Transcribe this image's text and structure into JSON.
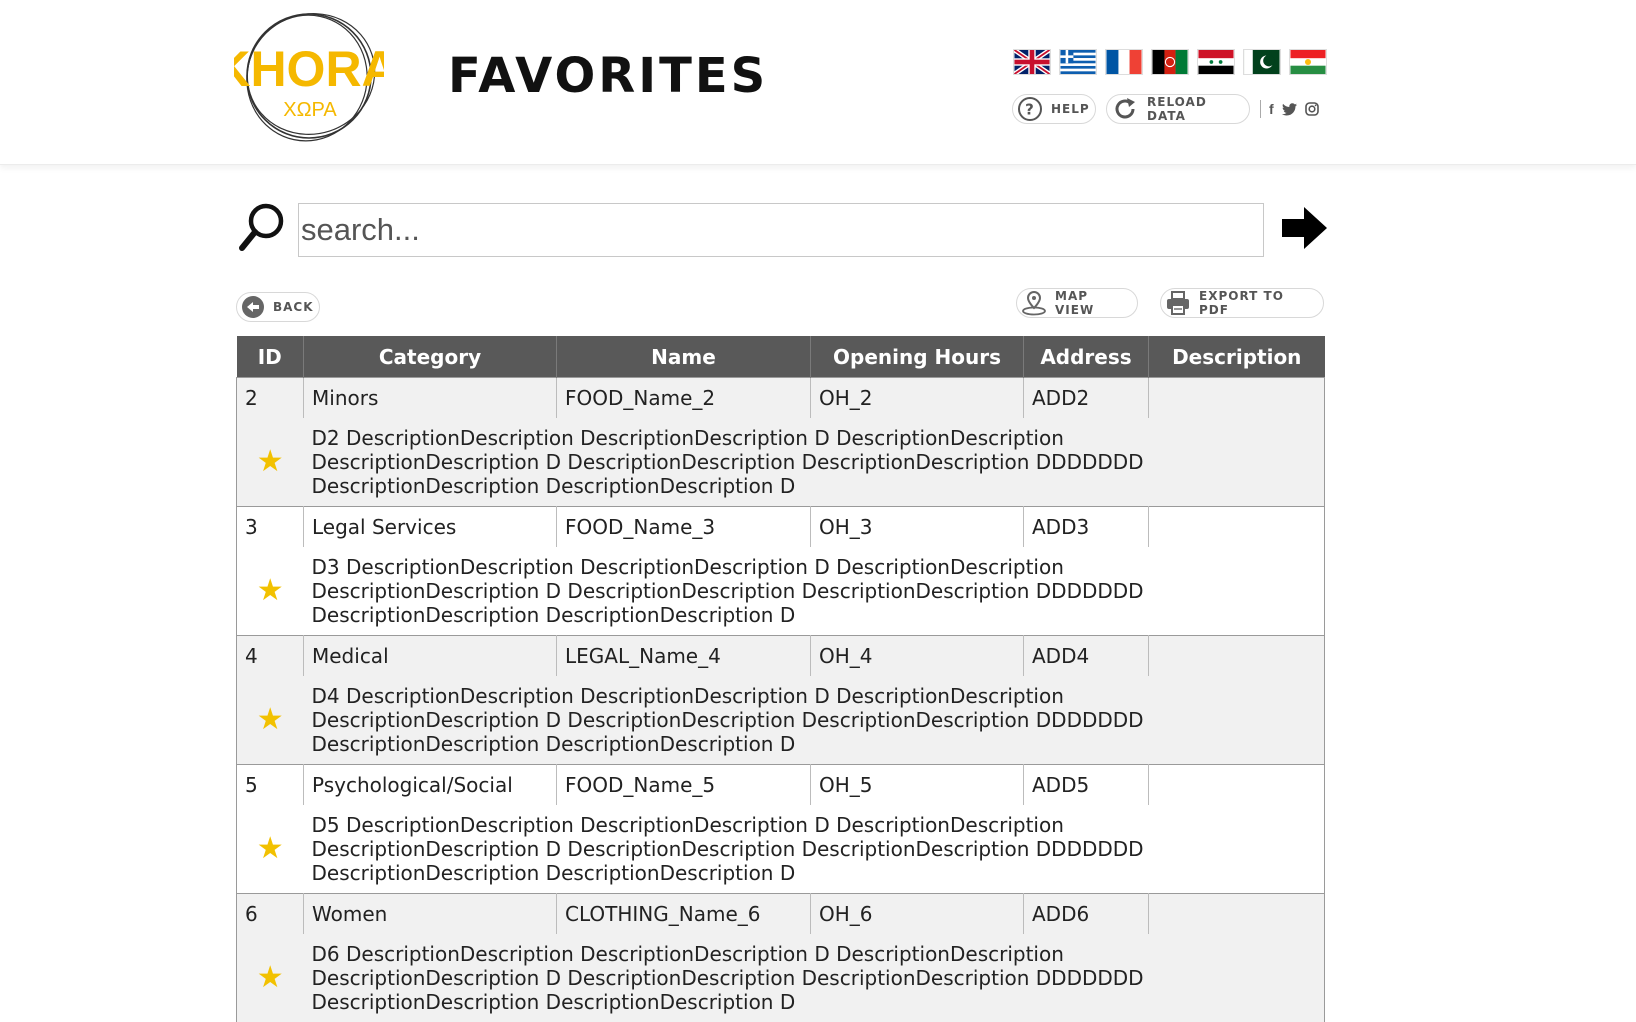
{
  "header": {
    "logo_text": "KHORA",
    "logo_subtext": "ΧΩΡΑ",
    "page_title": "FAVORITES",
    "flags": [
      "uk-flag",
      "greece-flag",
      "france-flag",
      "afghanistan-flag",
      "syria-flag",
      "pakistan-flag",
      "kurdistan-flag"
    ],
    "help_label": "HELP",
    "reload_label": "RELOAD DATA",
    "social": [
      "facebook-icon",
      "twitter-icon",
      "instagram-icon"
    ]
  },
  "search": {
    "placeholder": "search...",
    "value": ""
  },
  "actions": {
    "back_label": "BACK",
    "map_view_label": "MAP VIEW",
    "export_label": "EXPORT TO PDF"
  },
  "table": {
    "columns": [
      "ID",
      "Category",
      "Name",
      "Opening Hours",
      "Address",
      "Description"
    ],
    "rows": [
      {
        "id": "2",
        "category": "Minors",
        "name": "FOOD_Name_2",
        "hours": "OH_2",
        "address": "ADD2",
        "description": "D2 DescriptionDescription DescriptionDescription D DescriptionDescription DescriptionDescription D DescriptionDescription DescriptionDescription DDDDDDD DescriptionDescription DescriptionDescription D",
        "favorite": true
      },
      {
        "id": "3",
        "category": "Legal Services",
        "name": "FOOD_Name_3",
        "hours": "OH_3",
        "address": "ADD3",
        "description": "D3 DescriptionDescription DescriptionDescription D DescriptionDescription DescriptionDescription D DescriptionDescription DescriptionDescription DDDDDDD DescriptionDescription DescriptionDescription D",
        "favorite": true
      },
      {
        "id": "4",
        "category": "Medical",
        "name": "LEGAL_Name_4",
        "hours": "OH_4",
        "address": "ADD4",
        "description": "D4 DescriptionDescription DescriptionDescription D DescriptionDescription DescriptionDescription D DescriptionDescription DescriptionDescription DDDDDDD DescriptionDescription DescriptionDescription D",
        "favorite": true
      },
      {
        "id": "5",
        "category": "Psychological/Social",
        "name": "FOOD_Name_5",
        "hours": "OH_5",
        "address": "ADD5",
        "description": "D5 DescriptionDescription DescriptionDescription D DescriptionDescription DescriptionDescription D DescriptionDescription DescriptionDescription DDDDDDD DescriptionDescription DescriptionDescription D",
        "favorite": true
      },
      {
        "id": "6",
        "category": "Women",
        "name": "CLOTHING_Name_6",
        "hours": "OH_6",
        "address": "ADD6",
        "description": "D6 DescriptionDescription DescriptionDescription D DescriptionDescription DescriptionDescription D DescriptionDescription DescriptionDescription DDDDDDD DescriptionDescription DescriptionDescription D",
        "favorite": true
      }
    ],
    "star_glyph": "★",
    "star_color": "#f2c100",
    "header_bg": "#595959"
  },
  "colors": {
    "brand": "#f5b800"
  }
}
